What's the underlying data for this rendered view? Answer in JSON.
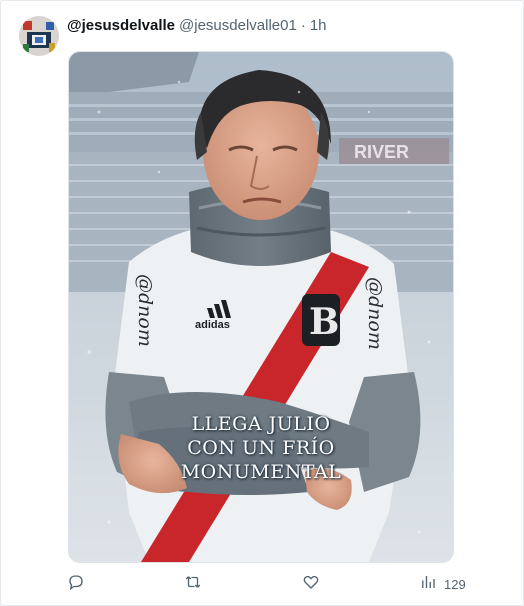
{
  "tweet": {
    "display_name": "@jesusdelvalle",
    "handle": "@jesusdelvalle01",
    "separator": "·",
    "time": "1h",
    "image": {
      "watermark": "@dnom",
      "stadium_sign": "RIVER",
      "shirt_badge": "B",
      "shirt_brand": "adidas",
      "caption_lines": [
        "LLEGA JULIO",
        "CON UN FRÍO",
        "MONUMENTAL"
      ]
    },
    "actions": {
      "reply_icon": "reply-icon",
      "retweet_icon": "retweet-icon",
      "like_icon": "heart-icon",
      "views_icon": "views-chart-icon",
      "views_count": "129"
    }
  }
}
